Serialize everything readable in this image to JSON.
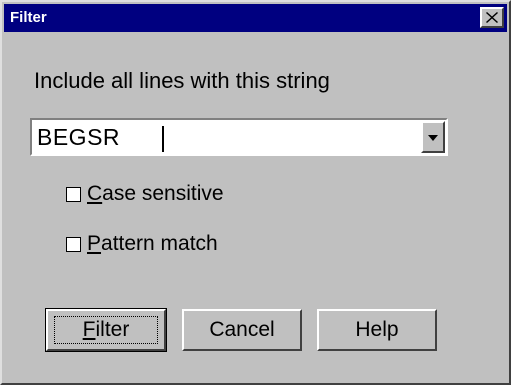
{
  "window": {
    "title": "Filter"
  },
  "prompt": "Include all lines with this string",
  "search": {
    "value": "BEGSR"
  },
  "options": {
    "case_sensitive": {
      "label_prefix": "",
      "accel": "C",
      "label_rest": "ase sensitive",
      "checked": false
    },
    "pattern_match": {
      "label_prefix": "",
      "accel": "P",
      "label_rest": "attern match",
      "checked": false
    }
  },
  "buttons": {
    "filter": {
      "accel": "F",
      "rest": "ilter"
    },
    "cancel": {
      "label": "Cancel"
    },
    "help": {
      "label": "Help"
    }
  },
  "icons": {
    "close": "close-icon",
    "dropdown": "chevron-down-icon"
  },
  "colors": {
    "titlebar": "#000080",
    "face": "#c0c0c0"
  }
}
